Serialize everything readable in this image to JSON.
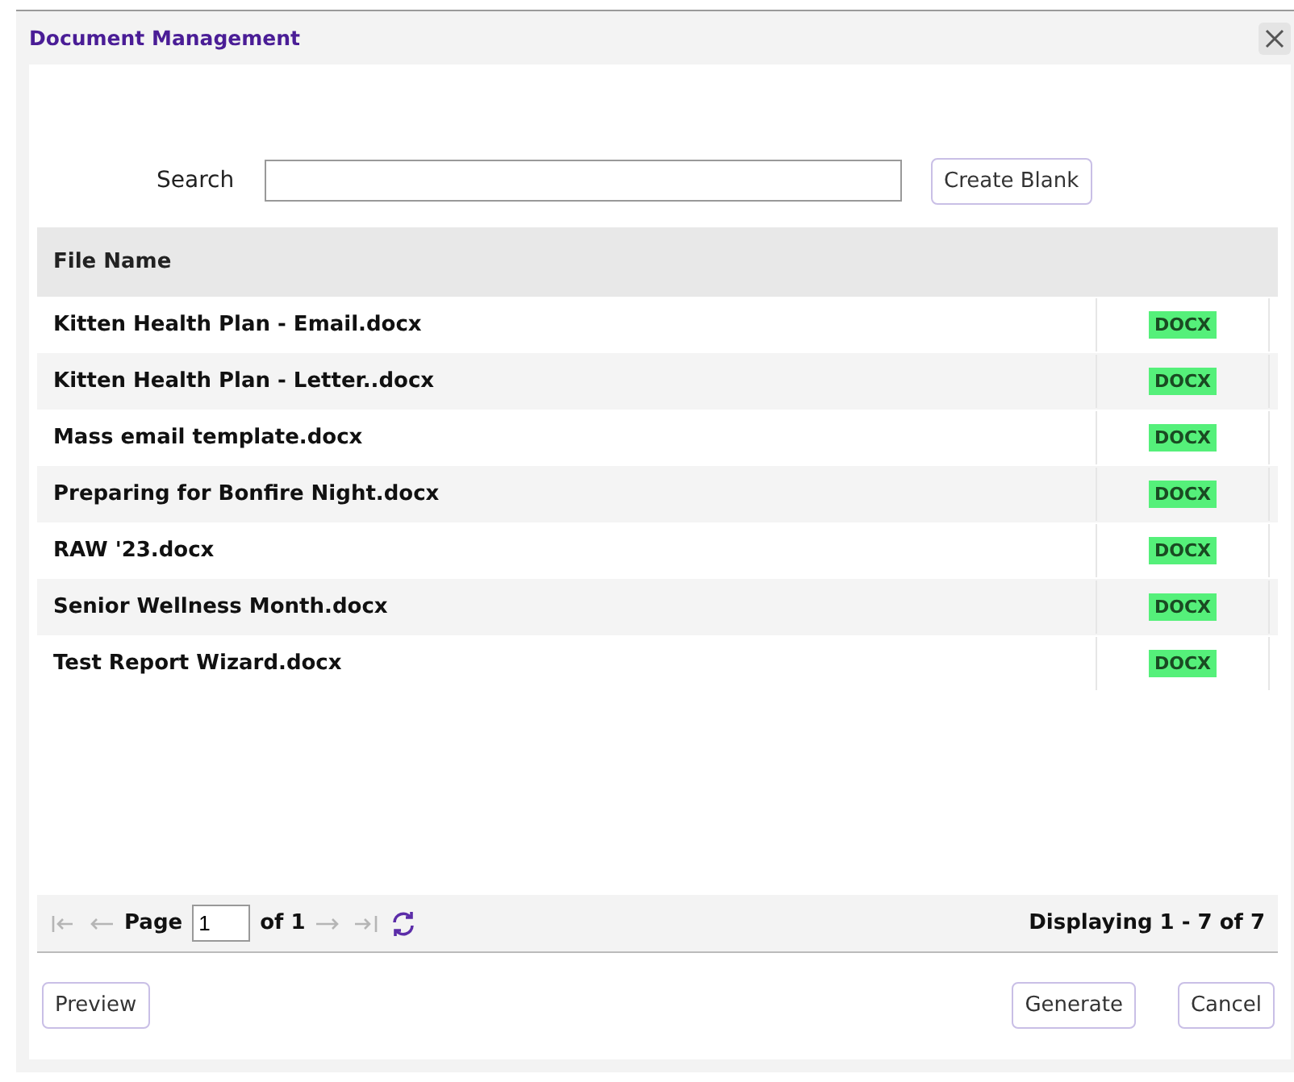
{
  "window": {
    "title": "Document Management"
  },
  "search": {
    "label": "Search"
  },
  "create_button": "Create Blank",
  "table": {
    "columns": [
      "File Name"
    ],
    "rows": [
      {
        "name": "Kitten Health Plan - Email.docx",
        "type": "DOCX"
      },
      {
        "name": "Kitten Health Plan - Letter..docx",
        "type": "DOCX"
      },
      {
        "name": "Mass email template.docx",
        "type": "DOCX"
      },
      {
        "name": "Preparing for Bonfire Night.docx",
        "type": "DOCX"
      },
      {
        "name": "RAW '23.docx",
        "type": "DOCX"
      },
      {
        "name": "Senior Wellness Month.docx",
        "type": "DOCX"
      },
      {
        "name": "Test Report Wizard.docx",
        "type": "DOCX"
      }
    ]
  },
  "pager": {
    "nav_back": [
      {
        "kind": "first",
        "disabled": true
      },
      {
        "kind": "prev",
        "disabled": true
      }
    ],
    "page_label": "Page",
    "page_value": "1",
    "page_total": "of 1",
    "nav_forward": [
      {
        "kind": "next",
        "disabled": true
      },
      {
        "kind": "last",
        "disabled": true
      }
    ],
    "displaying": "Displaying 1 - 7 of 7"
  },
  "footer": {
    "left": [
      "Preview"
    ],
    "right": [
      "Generate",
      "Cancel"
    ]
  }
}
